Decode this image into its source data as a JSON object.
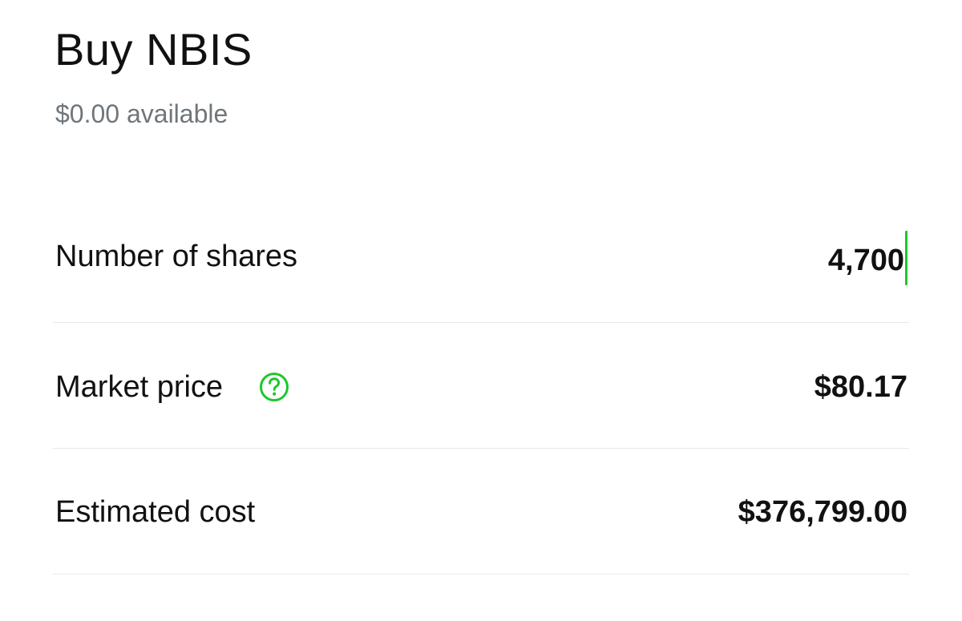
{
  "header": {
    "title": "Buy NBIS",
    "available": "$0.00 available"
  },
  "order": {
    "shares_label": "Number of shares",
    "shares_value": "4,700",
    "market_price_label": "Market price",
    "market_price_value": "$80.17",
    "estimated_cost_label": "Estimated cost",
    "estimated_cost_value": "$376,799.00"
  },
  "icons": {
    "market_price_help": "question-circle-icon"
  },
  "colors": {
    "accent": "#1ec72c",
    "text": "#111111",
    "muted": "#6f767b",
    "divider": "#e8e8e8"
  }
}
